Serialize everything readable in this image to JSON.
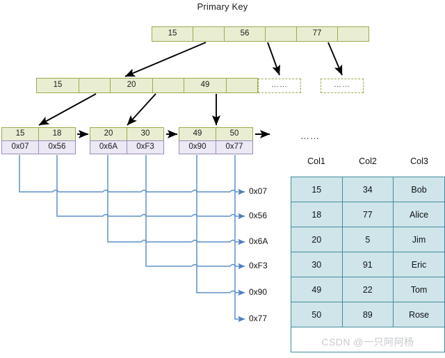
{
  "title": "Primary Key",
  "root_node": {
    "cells": [
      "15",
      "",
      "56",
      "",
      "77",
      ""
    ]
  },
  "internal_node": {
    "cells": [
      "15",
      "",
      "20",
      "",
      "49",
      ""
    ]
  },
  "placeholder_nodes": [
    {
      "label": "……"
    },
    {
      "label": "……"
    }
  ],
  "leaf_nodes": [
    {
      "keys": [
        "15",
        "18"
      ],
      "pointers": [
        "0x07",
        "0x56"
      ]
    },
    {
      "keys": [
        "20",
        "30"
      ],
      "pointers": [
        "0x6A",
        "0xF3"
      ]
    },
    {
      "keys": [
        "49",
        "50"
      ],
      "pointers": [
        "0x90",
        "0x77"
      ]
    }
  ],
  "address_labels": [
    "0x07",
    "0x56",
    "0x6A",
    "0xF3",
    "0x90",
    "0x77"
  ],
  "table": {
    "ellipsis": "……",
    "headers": [
      "Col1",
      "Col2",
      "Col3"
    ],
    "rows": [
      [
        "15",
        "34",
        "Bob"
      ],
      [
        "18",
        "77",
        "Alice"
      ],
      [
        "20",
        "5",
        "Jim"
      ],
      [
        "30",
        "91",
        "Eric"
      ],
      [
        "49",
        "22",
        "Tom"
      ],
      [
        "50",
        "89",
        "Rose"
      ]
    ]
  },
  "watermark": "CSDN @一只阿阿杨",
  "colors": {
    "key_fill": "#e9eed2",
    "key_border": "#9aaa4b",
    "pointer_fill": "#ece8f4",
    "pointer_border": "#9a8bbd",
    "table_fill": "#cfe5ea",
    "table_border": "#3f8c9b",
    "connector": "#5b8fc9",
    "arrow": "#000000"
  }
}
